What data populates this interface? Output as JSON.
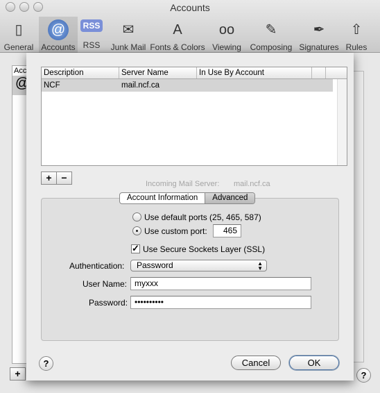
{
  "window": {
    "title": "Accounts"
  },
  "toolbar": [
    {
      "label": "General",
      "icon": "switch-icon",
      "glyph": "▯"
    },
    {
      "label": "Accounts",
      "icon": "at-icon",
      "glyph": "@"
    },
    {
      "label": "RSS",
      "icon": "rss-icon",
      "glyph": "RSS"
    },
    {
      "label": "Junk Mail",
      "icon": "junk-mail-icon",
      "glyph": "✉"
    },
    {
      "label": "Fonts & Colors",
      "icon": "fonts-colors-icon",
      "glyph": "A"
    },
    {
      "label": "Viewing",
      "icon": "glasses-icon",
      "glyph": "oo"
    },
    {
      "label": "Composing",
      "icon": "pencil-icon",
      "glyph": "✎"
    },
    {
      "label": "Signatures",
      "icon": "pen-icon",
      "glyph": "✒"
    },
    {
      "label": "Rules",
      "icon": "rules-icon",
      "glyph": "⇧"
    }
  ],
  "background": {
    "list_header": "Acc",
    "ghost_label": "Incoming Mail Server:",
    "ghost_value": "mail.ncf.ca",
    "add": "+",
    "help": "?"
  },
  "sheet": {
    "table": {
      "columns": [
        "Description",
        "Server Name",
        "In Use By Account"
      ],
      "rows": [
        {
          "description": "NCF",
          "server": "mail.ncf.ca",
          "in_use": ""
        }
      ]
    },
    "add": "+",
    "remove": "−",
    "tabs": [
      "Account Information",
      "Advanced"
    ],
    "default_ports_label": "Use default ports (25, 465, 587)",
    "custom_port_label": "Use custom port:",
    "custom_port": "465",
    "ssl_label": "Use Secure Sockets Layer (SSL)",
    "ssl_checked": true,
    "auth_label": "Authentication:",
    "auth_value": "Password",
    "username_label": "User Name:",
    "username": "myxxx",
    "password_label": "Password:",
    "password": "••••••••••",
    "help": "?",
    "cancel": "Cancel",
    "ok": "OK"
  }
}
